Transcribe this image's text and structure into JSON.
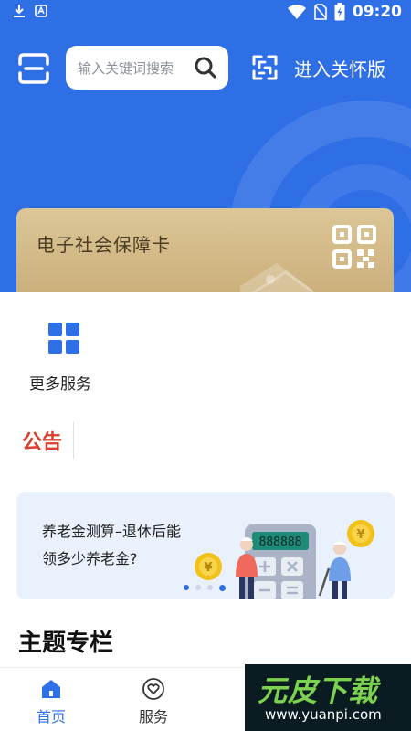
{
  "status_bar": {
    "time": "09:20",
    "left_icons": [
      "download-icon",
      "notification-a-icon"
    ],
    "right_icons": [
      "wifi-icon",
      "no-sim-icon",
      "battery-charging-icon"
    ]
  },
  "header": {
    "search": {
      "placeholder": "输入关键词搜索"
    },
    "care_mode_label": "进入关怀版"
  },
  "social_security_card": {
    "title": "电子社会保障卡"
  },
  "services": [
    {
      "label": "更多服务",
      "icon": "grid-icon"
    }
  ],
  "notice": {
    "title": "公告"
  },
  "banner": {
    "line1": "养老金测算–退休后能",
    "line2": "领多少养老金?",
    "calculator_display": "888888",
    "coin_symbol": "¥",
    "indicator": {
      "count": 4,
      "active_index": 3
    }
  },
  "section": {
    "title": "主题专栏"
  },
  "tab_bar": {
    "tabs": [
      {
        "label": "首页",
        "icon": "home-icon",
        "active": true
      },
      {
        "label": "服务",
        "icon": "heart-icon",
        "active": false
      }
    ]
  },
  "watermark": {
    "title": "元皮下载",
    "url": "www.yuanpi.com"
  },
  "colors": {
    "primary": "#2f6fe6",
    "card_gold": "#cbb07b",
    "notice_red": "#d7402e",
    "banner_bg": "#e9f1fd"
  }
}
